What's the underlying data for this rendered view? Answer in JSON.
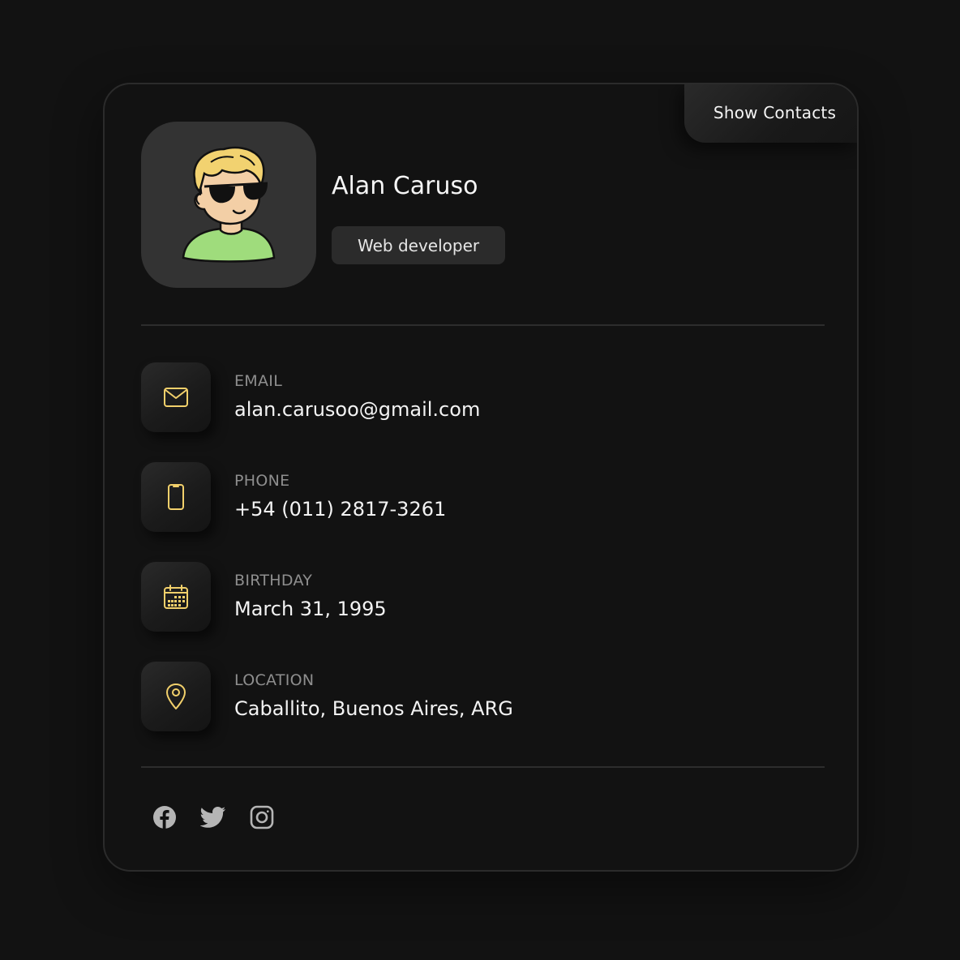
{
  "header": {
    "show_contacts_label": "Show Contacts"
  },
  "profile": {
    "name": "Alan Caruso",
    "role": "Web developer",
    "avatar_icon": "cartoon-avatar-sunglasses"
  },
  "contacts": [
    {
      "label": "EMAIL",
      "value": "alan.carusoo@gmail.com",
      "icon": "mail-icon"
    },
    {
      "label": "PHONE",
      "value": "+54 (011) 2817-3261",
      "icon": "phone-icon"
    },
    {
      "label": "BIRTHDAY",
      "value": "March 31, 1995",
      "icon": "calendar-icon"
    },
    {
      "label": "LOCATION",
      "value": "Caballito, Buenos Aires, ARG",
      "icon": "map-pin-icon"
    }
  ],
  "socials": [
    {
      "name": "facebook",
      "icon": "facebook-icon"
    },
    {
      "name": "twitter",
      "icon": "twitter-icon"
    },
    {
      "name": "instagram",
      "icon": "instagram-icon"
    }
  ],
  "colors": {
    "background": "#121212",
    "accent_icon": "#f2d06b",
    "social_icon": "#b5b5b5"
  }
}
